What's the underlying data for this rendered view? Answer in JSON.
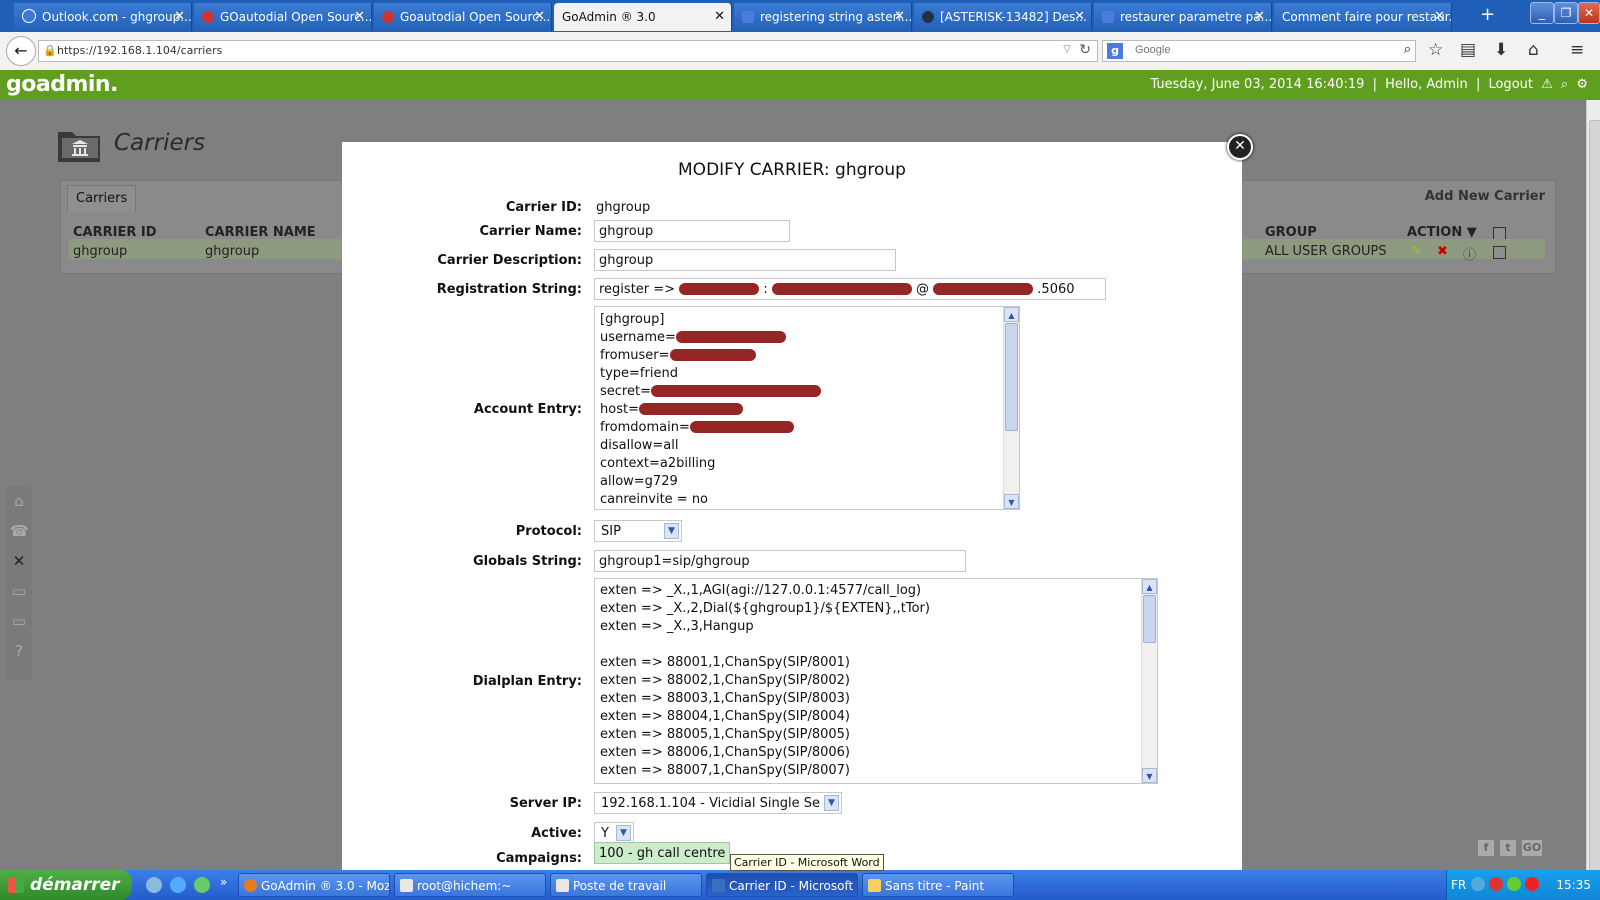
{
  "browser": {
    "tabs": [
      {
        "label": "Outlook.com - ghgroup..."
      },
      {
        "label": "GOautodial Open Sourc..."
      },
      {
        "label": "Goautodial Open Sourc..."
      },
      {
        "label": "GoAdmin ® 3.0"
      },
      {
        "label": "registering string asteri..."
      },
      {
        "label": "[ASTERISK-13482] Des..."
      },
      {
        "label": "restaurer parametre pa..."
      },
      {
        "label": "Comment faire pour restaur..."
      }
    ],
    "active_tab_index": 3,
    "new_tab_symbol": "+",
    "url": "https://192.168.1.104/carriers",
    "search_placeholder": "Google"
  },
  "app": {
    "logo": "goadmin.",
    "datetime": "Tuesday, June 03, 2014 16:40:19",
    "greeting": "Hello, Admin",
    "logout": "Logout",
    "sep": "|",
    "accent_color": "#5f9e1f"
  },
  "page": {
    "title": "Carriers",
    "tab_label": "Carriers",
    "add_new": "Add New Carrier",
    "columns": {
      "carrier_id": "CARRIER ID",
      "carrier_name": "CARRIER NAME",
      "group": "GROUP",
      "action": "ACTION ▼"
    },
    "rows": [
      {
        "carrier_id": "ghgroup",
        "carrier_name": "ghgroup",
        "group": "ALL USER GROUPS"
      }
    ]
  },
  "modal": {
    "title": "MODIFY CARRIER: ghgroup",
    "labels": {
      "carrier_id": "Carrier ID:",
      "carrier_name": "Carrier Name:",
      "carrier_description": "Carrier Description:",
      "registration_string": "Registration String:",
      "account_entry": "Account Entry:",
      "protocol": "Protocol:",
      "globals_string": "Globals String:",
      "dialplan_entry": "Dialplan Entry:",
      "server_ip": "Server IP:",
      "active": "Active:",
      "campaigns": "Campaigns:"
    },
    "values": {
      "carrier_id": "ghgroup",
      "carrier_name": "ghgroup",
      "carrier_description": "ghgroup",
      "registration_prefix": "register =>",
      "registration_sep1": ":",
      "registration_at": "@",
      "registration_port": ".5060",
      "protocol": "SIP",
      "globals_string": "ghgroup1=sip/ghgroup",
      "server_ip": "192.168.1.104 - Vicidial Single Se",
      "active": "Y",
      "campaign": "100 - gh call centre"
    },
    "account_entry_lines": [
      "[ghgroup]",
      "username=",
      "fromuser=",
      "type=friend",
      "secret=",
      "host=",
      "fromdomain=",
      "disallow=all",
      "context=a2billing",
      "allow=g729",
      "canreinvite = no"
    ],
    "dialplan_lines": [
      "exten => _X.,1,AGI(agi://127.0.0.1:4577/call_log)",
      "exten => _X.,2,Dial(${ghgroup1}/${EXTEN},,tTor)",
      "exten => _X.,3,Hangup",
      "",
      "exten => 88001,1,ChanSpy(SIP/8001)",
      "exten => 88002,1,ChanSpy(SIP/8002)",
      "exten => 88003,1,ChanSpy(SIP/8003)",
      "exten => 88004,1,ChanSpy(SIP/8004)",
      "exten => 88005,1,ChanSpy(SIP/8005)",
      "exten => 88006,1,ChanSpy(SIP/8006)",
      "exten => 88007,1,ChanSpy(SIP/8007)"
    ],
    "close_symbol": "✕",
    "tooltip": "Carrier ID - Microsoft Word"
  },
  "taskbar": {
    "start": "démarrer",
    "tasks": [
      {
        "label": "GoAdmin ® 3.0 - Moz..."
      },
      {
        "label": "root@hichem:~"
      },
      {
        "label": "Poste de travail"
      },
      {
        "label": "Carrier ID - Microsoft ..."
      },
      {
        "label": "Sans titre - Paint"
      }
    ],
    "active_task_index": 3,
    "lang": "FR",
    "clock": "15:35"
  }
}
